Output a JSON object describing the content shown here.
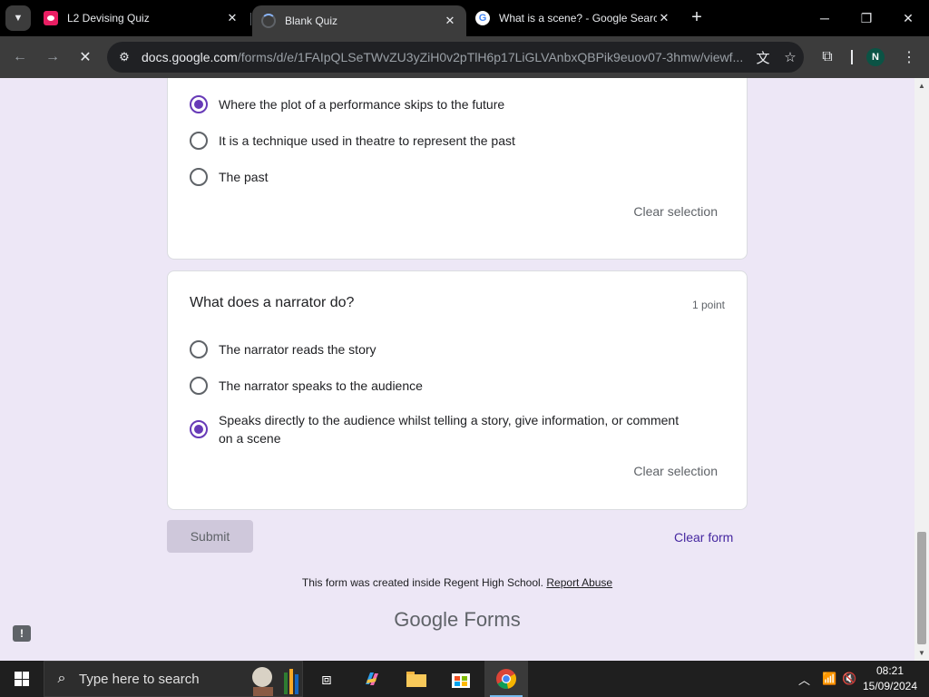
{
  "browser": {
    "tabs": [
      {
        "title": "L2 Devising Quiz",
        "icon": "google-forms-icon",
        "active": false
      },
      {
        "title": "Blank Quiz",
        "icon": "loading-spinner-icon",
        "active": true
      },
      {
        "title": "What is a scene? - Google Search",
        "icon": "google-icon",
        "active": false
      }
    ],
    "url_host": "docs.google.com",
    "url_path": "/forms/d/e/1FAIpQLSeTWvZU3yZiH0v2pTlH6p17LiGLVAnbxQBPik9euov07-3hmw/viewf...",
    "profile_initial": "N"
  },
  "form": {
    "question1": {
      "options": [
        {
          "label": "Where the plot of a performance skips to the future",
          "checked": true
        },
        {
          "label": "It is a technique used in theatre to represent the past",
          "checked": false
        },
        {
          "label": "The past",
          "checked": false
        }
      ],
      "clear_label": "Clear selection"
    },
    "question2": {
      "title": "What does a narrator do?",
      "points": "1 point",
      "options": [
        {
          "label": "The narrator reads the story",
          "checked": false
        },
        {
          "label": "The narrator speaks to the audience",
          "checked": false
        },
        {
          "label": "Speaks directly to the audience whilst telling a story, give information, or comment on a scene",
          "checked": true
        }
      ],
      "clear_label": "Clear selection"
    },
    "submit_label": "Submit",
    "clear_form_label": "Clear form",
    "footer_text": "This form was created inside Regent High School.",
    "report_link": "Report Abuse",
    "brand_google": "Google",
    "brand_forms": "Forms",
    "accent_color": "#673ab7"
  },
  "taskbar": {
    "search_placeholder": "Type here to search",
    "time": "08:21",
    "date": "15/09/2024"
  }
}
